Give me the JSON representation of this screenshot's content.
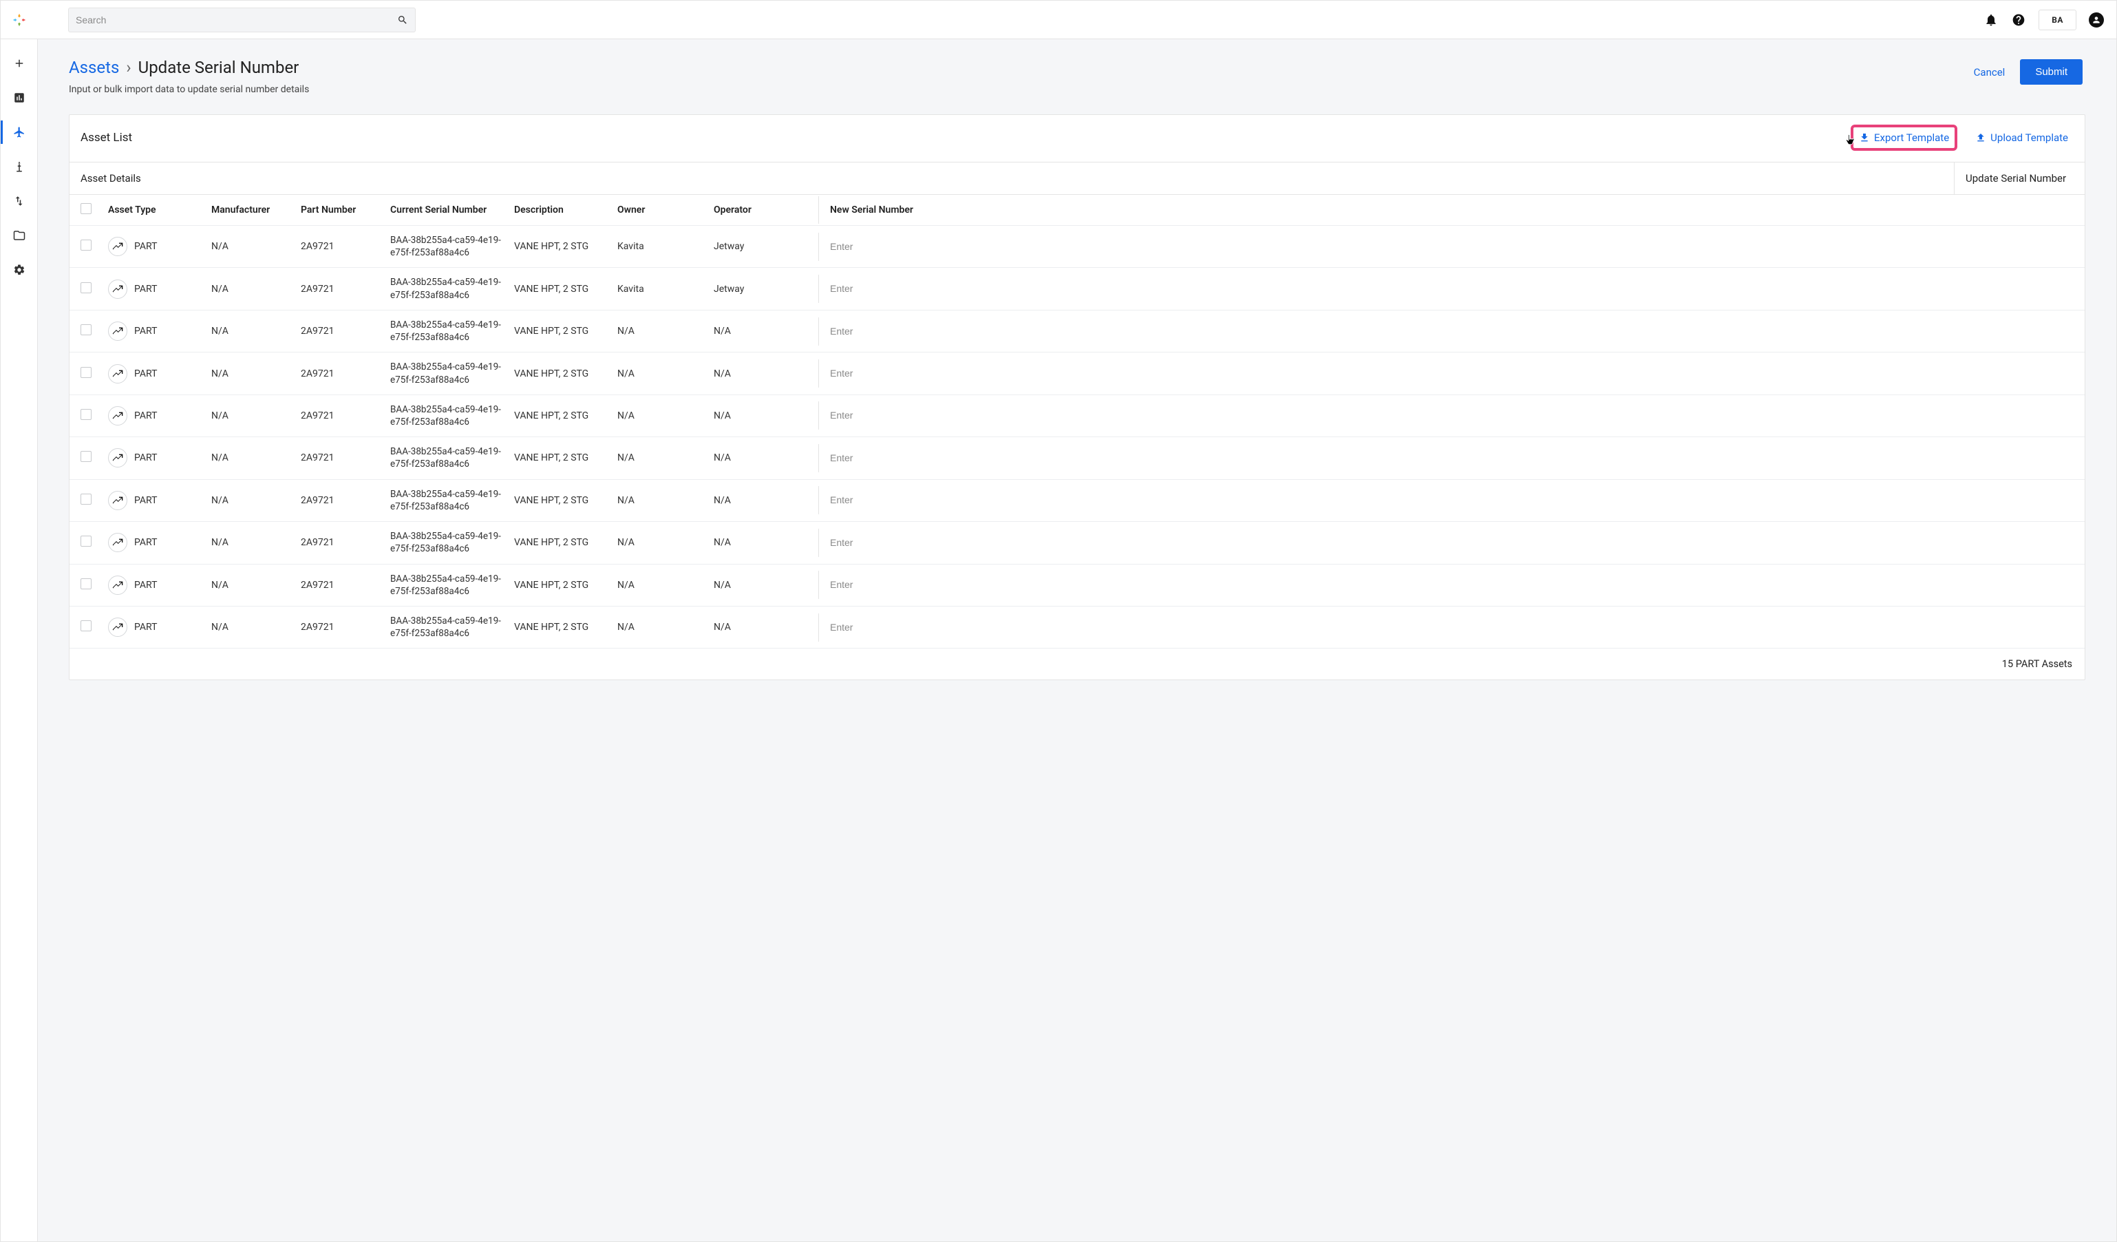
{
  "topbar": {
    "search_placeholder": "Search",
    "user_initials": "BA"
  },
  "breadcrumbs": {
    "root": "Assets",
    "separator": "›",
    "current": "Update Serial Number"
  },
  "page": {
    "subtitle": "Input or bulk import data to update serial number details",
    "cancel_label": "Cancel",
    "submit_label": "Submit"
  },
  "panel": {
    "title": "Asset List",
    "export_label": "Export Template",
    "upload_label": "Upload Template",
    "details_heading": "Asset Details",
    "update_heading": "Update Serial Number",
    "footer_text": "15 PART Assets"
  },
  "columns": {
    "asset_type": "Asset Type",
    "manufacturer": "Manufacturer",
    "part_number": "Part Number",
    "current_serial": "Current Serial Number",
    "description": "Description",
    "owner": "Owner",
    "operator": "Operator",
    "new_serial": "New Serial Number"
  },
  "new_serial_placeholder": "Enter",
  "rows": [
    {
      "asset_type": "PART",
      "manufacturer": "N/A",
      "part_number": "2A9721",
      "current_serial": "BAA-38b255a4-ca59-4e19-e75f-f253af88a4c6",
      "description": "VANE HPT, 2 STG",
      "owner": "Kavita",
      "operator": "Jetway"
    },
    {
      "asset_type": "PART",
      "manufacturer": "N/A",
      "part_number": "2A9721",
      "current_serial": "BAA-38b255a4-ca59-4e19-e75f-f253af88a4c6",
      "description": "VANE HPT, 2 STG",
      "owner": "Kavita",
      "operator": "Jetway"
    },
    {
      "asset_type": "PART",
      "manufacturer": "N/A",
      "part_number": "2A9721",
      "current_serial": "BAA-38b255a4-ca59-4e19-e75f-f253af88a4c6",
      "description": "VANE HPT, 2 STG",
      "owner": "N/A",
      "operator": "N/A"
    },
    {
      "asset_type": "PART",
      "manufacturer": "N/A",
      "part_number": "2A9721",
      "current_serial": "BAA-38b255a4-ca59-4e19-e75f-f253af88a4c6",
      "description": "VANE HPT, 2 STG",
      "owner": "N/A",
      "operator": "N/A"
    },
    {
      "asset_type": "PART",
      "manufacturer": "N/A",
      "part_number": "2A9721",
      "current_serial": "BAA-38b255a4-ca59-4e19-e75f-f253af88a4c6",
      "description": "VANE HPT, 2 STG",
      "owner": "N/A",
      "operator": "N/A"
    },
    {
      "asset_type": "PART",
      "manufacturer": "N/A",
      "part_number": "2A9721",
      "current_serial": "BAA-38b255a4-ca59-4e19-e75f-f253af88a4c6",
      "description": "VANE HPT, 2 STG",
      "owner": "N/A",
      "operator": "N/A"
    },
    {
      "asset_type": "PART",
      "manufacturer": "N/A",
      "part_number": "2A9721",
      "current_serial": "BAA-38b255a4-ca59-4e19-e75f-f253af88a4c6",
      "description": "VANE HPT, 2 STG",
      "owner": "N/A",
      "operator": "N/A"
    },
    {
      "asset_type": "PART",
      "manufacturer": "N/A",
      "part_number": "2A9721",
      "current_serial": "BAA-38b255a4-ca59-4e19-e75f-f253af88a4c6",
      "description": "VANE HPT, 2 STG",
      "owner": "N/A",
      "operator": "N/A"
    },
    {
      "asset_type": "PART",
      "manufacturer": "N/A",
      "part_number": "2A9721",
      "current_serial": "BAA-38b255a4-ca59-4e19-e75f-f253af88a4c6",
      "description": "VANE HPT, 2 STG",
      "owner": "N/A",
      "operator": "N/A"
    },
    {
      "asset_type": "PART",
      "manufacturer": "N/A",
      "part_number": "2A9721",
      "current_serial": "BAA-38b255a4-ca59-4e19-e75f-f253af88a4c6",
      "description": "VANE HPT, 2 STG",
      "owner": "N/A",
      "operator": "N/A"
    }
  ]
}
